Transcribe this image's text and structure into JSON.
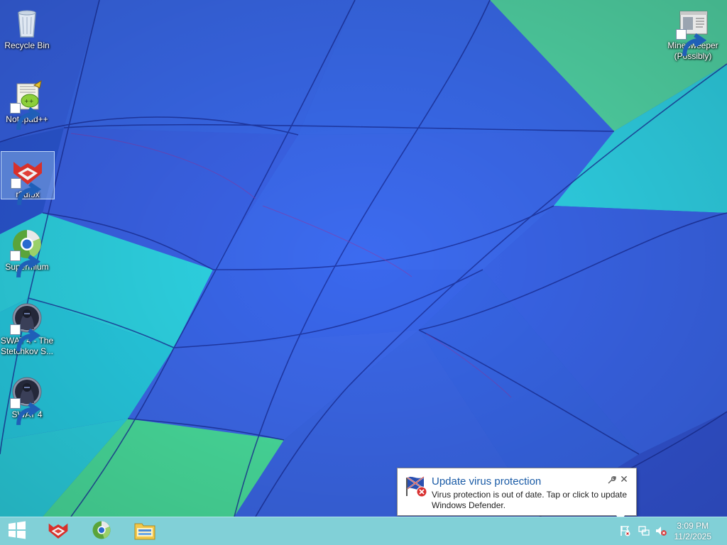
{
  "desktop": {
    "icons": [
      {
        "label": "Recycle Bin",
        "icon": "recycle-bin-icon"
      },
      {
        "label": "Notepad++",
        "icon": "notepad-plus-plus-icon"
      },
      {
        "label": "r3dfox",
        "icon": "r3dfox-icon"
      },
      {
        "label": "Supermium",
        "icon": "supermium-icon"
      },
      {
        "label": "SWAT 4 - The\nStetchkov S...",
        "icon": "swat4-stetchkov-icon"
      },
      {
        "label": "SWAT 4",
        "icon": "swat4-icon"
      },
      {
        "label": "Minesweeper\n(Possibly)",
        "icon": "minesweeper-icon"
      }
    ]
  },
  "taskbar": {
    "pinned": [
      "start-icon",
      "r3dfox-icon",
      "supermium-icon",
      "file-explorer-icon"
    ],
    "tray": [
      "action-center-flag-icon",
      "network-icon",
      "volume-muted-icon"
    ],
    "clock": {
      "time": "3:09 PM",
      "date": "11/2/2025"
    }
  },
  "notification": {
    "title": "Update virus protection",
    "message": "Virus protection is out of date. Tap or click to update Windows Defender.",
    "icons": [
      "defender-warning-icon",
      "options-wrench-icon",
      "close-icon"
    ],
    "close_glyph": "✕"
  },
  "colors": {
    "taskbar": "#76ccd4",
    "title": "#1a5ba6"
  }
}
